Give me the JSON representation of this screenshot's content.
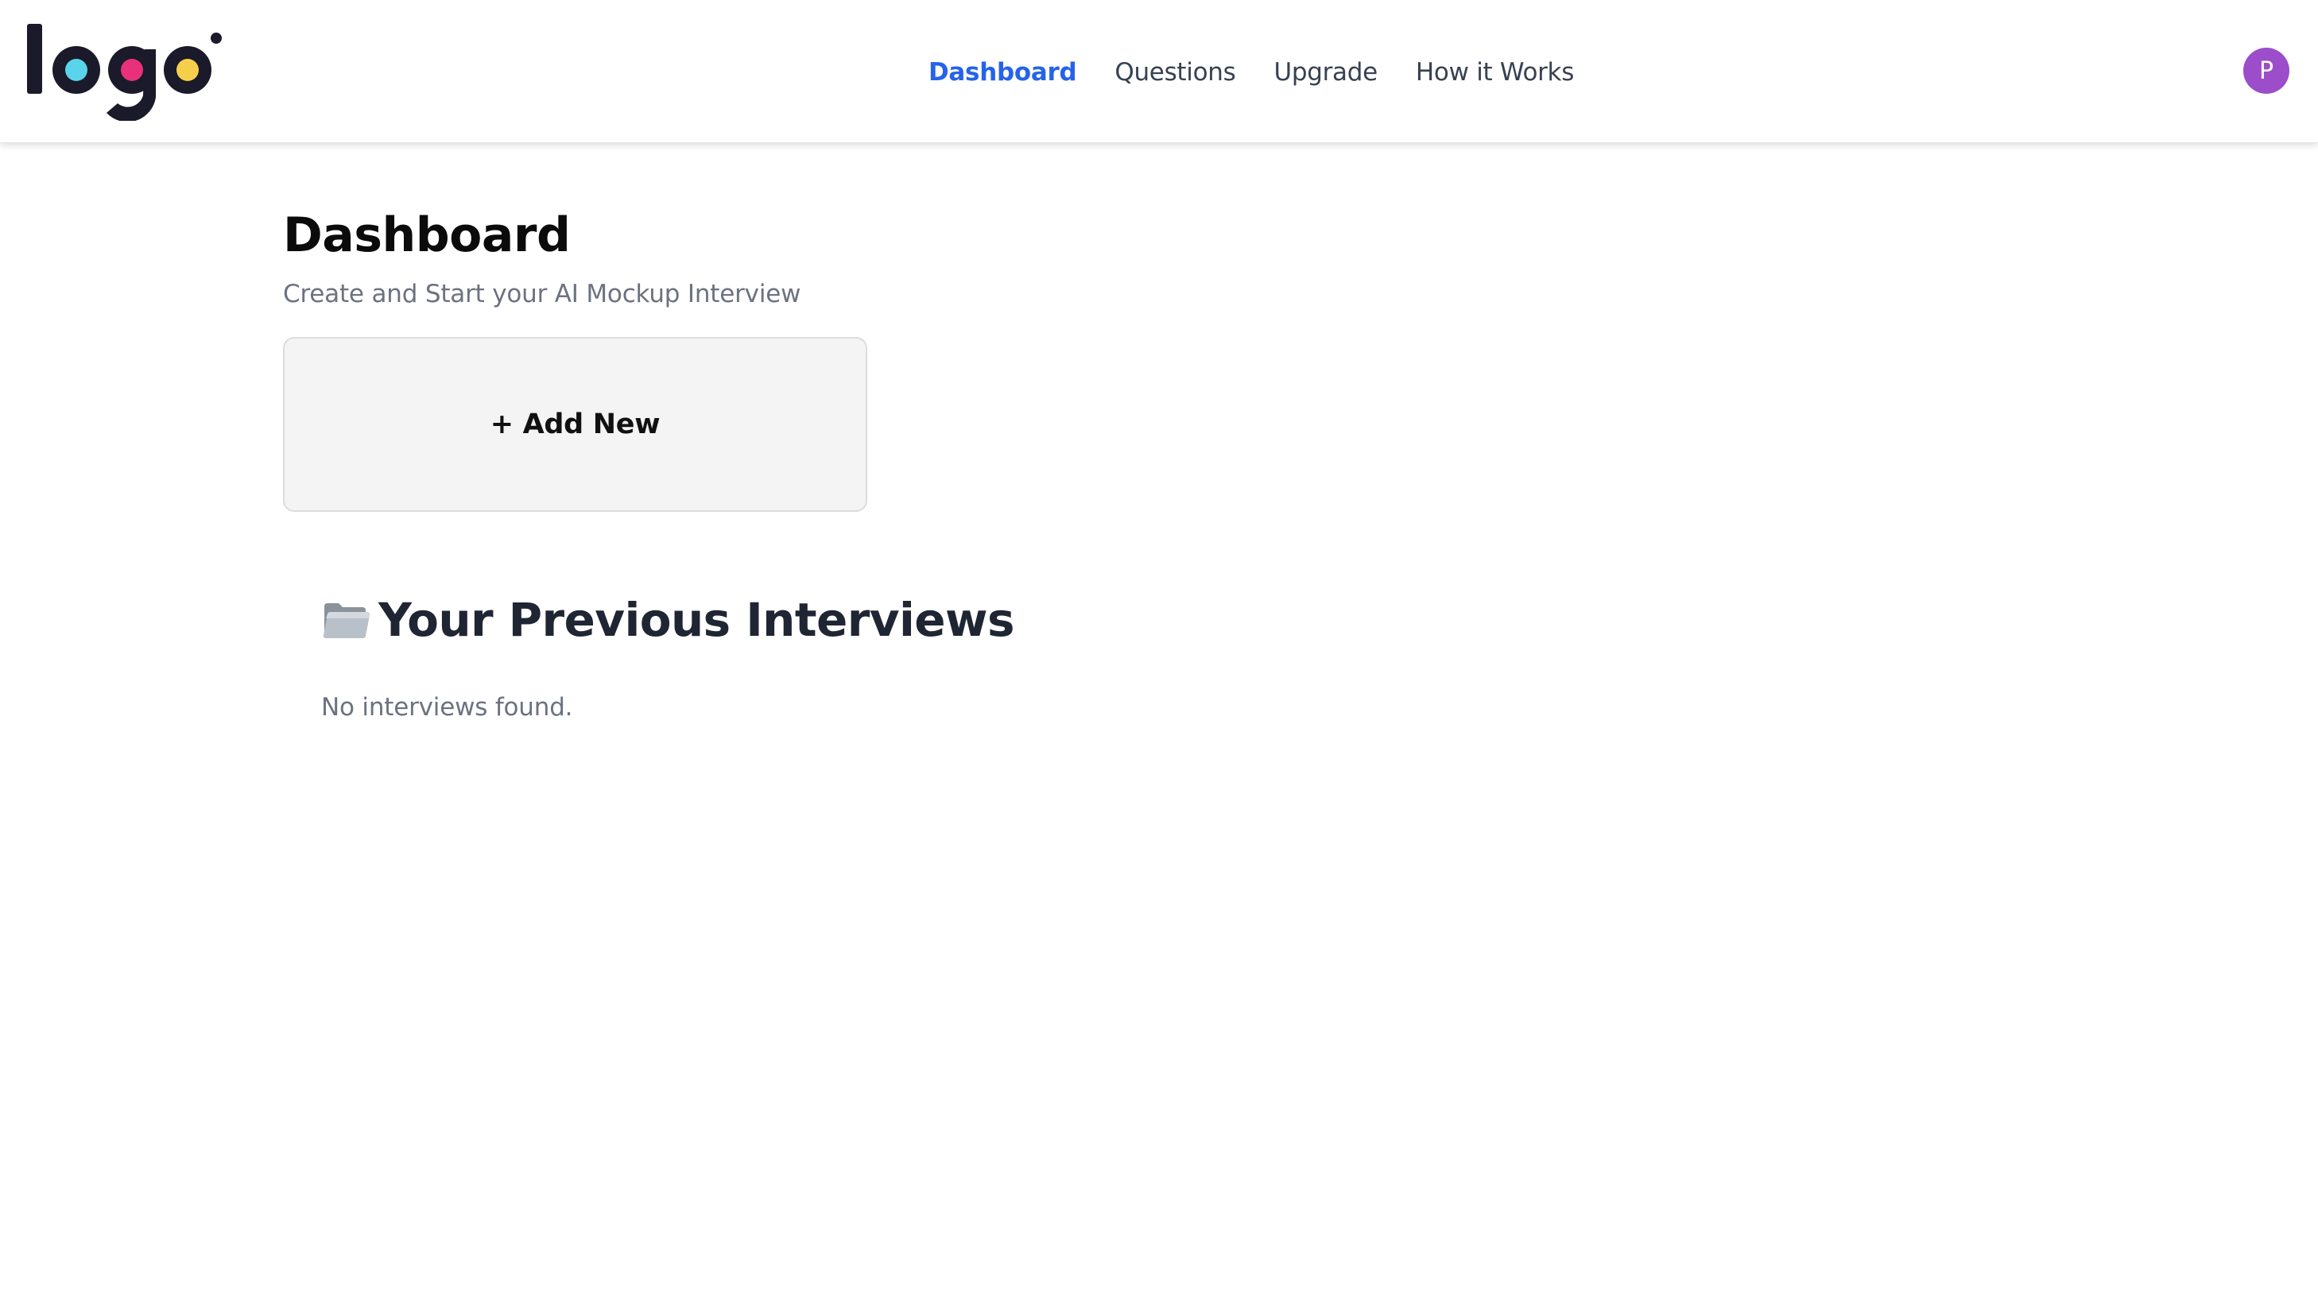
{
  "header": {
    "logo_text": "logo",
    "nav": [
      {
        "label": "Dashboard",
        "active": true
      },
      {
        "label": "Questions",
        "active": false
      },
      {
        "label": "Upgrade",
        "active": false
      },
      {
        "label": "How it Works",
        "active": false
      }
    ],
    "avatar_initial": "P",
    "colors": {
      "active_nav": "#2563eb",
      "avatar_bg": "#9b4dca",
      "logo_dot_1": "#5ad4ea",
      "logo_dot_2": "#e8317a",
      "logo_dot_3": "#f6cf4a"
    }
  },
  "main": {
    "title": "Dashboard",
    "subtitle": "Create and Start your AI Mockup Interview",
    "add_new_label": "+ Add New",
    "previous": {
      "icon": "folder-icon",
      "title": "Your Previous Interviews",
      "empty_message": "No interviews found."
    }
  }
}
